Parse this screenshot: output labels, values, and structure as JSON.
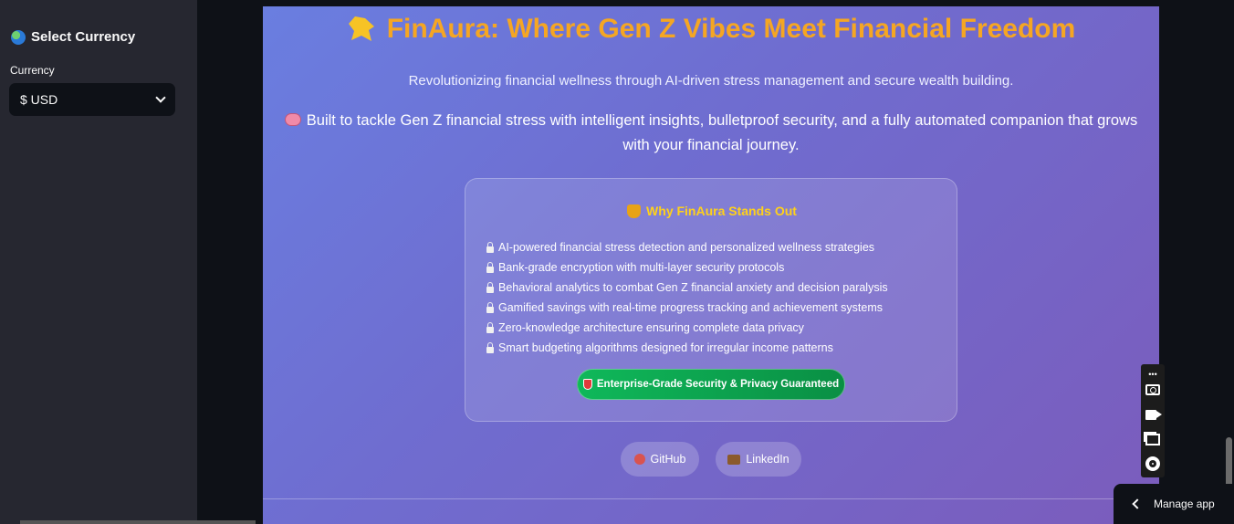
{
  "sidebar": {
    "title": "Select Currency",
    "currency_label": "Currency",
    "currency_selected": "$ USD"
  },
  "hero": {
    "title": "FinAura: Where Gen Z Vibes Meet Financial Freedom",
    "subtitle": "Revolutionizing financial wellness through AI-driven stress management and secure wealth building.",
    "description": "Built to tackle Gen Z financial stress with intelligent insights, bulletproof security, and a fully automated companion that grows with your financial journey."
  },
  "card": {
    "title": "Why FinAura Stands Out",
    "features": [
      "AI-powered financial stress detection and personalized wellness strategies",
      "Bank-grade encryption with multi-layer security protocols",
      "Behavioral analytics to combat Gen Z financial anxiety and decision paralysis",
      "Gamified savings with real-time progress tracking and achievement systems",
      "Zero-knowledge architecture ensuring complete data privacy",
      "Smart budgeting algorithms designed for irregular income patterns"
    ],
    "badge": "Enterprise-Grade Security & Privacy Guaranteed"
  },
  "links": {
    "github": "GitHub",
    "linkedin": "LinkedIn"
  },
  "toolbar": {
    "dots": "•••"
  },
  "manage_app": "Manage app",
  "colors": {
    "title": "#f5a623",
    "card_title": "#ffd11a",
    "badge": "#0fb85a",
    "sidebar_bg": "#262730",
    "app_bg": "#0e1117"
  },
  "icons": [
    "globe-icon",
    "star-logo-icon",
    "brain-icon",
    "trophy-icon",
    "lock-icon",
    "shield-icon",
    "octopus-icon",
    "briefcase-icon",
    "camera-icon",
    "video-icon",
    "window-icon",
    "gear-icon",
    "chevron-down-icon",
    "chevron-left-icon"
  ]
}
